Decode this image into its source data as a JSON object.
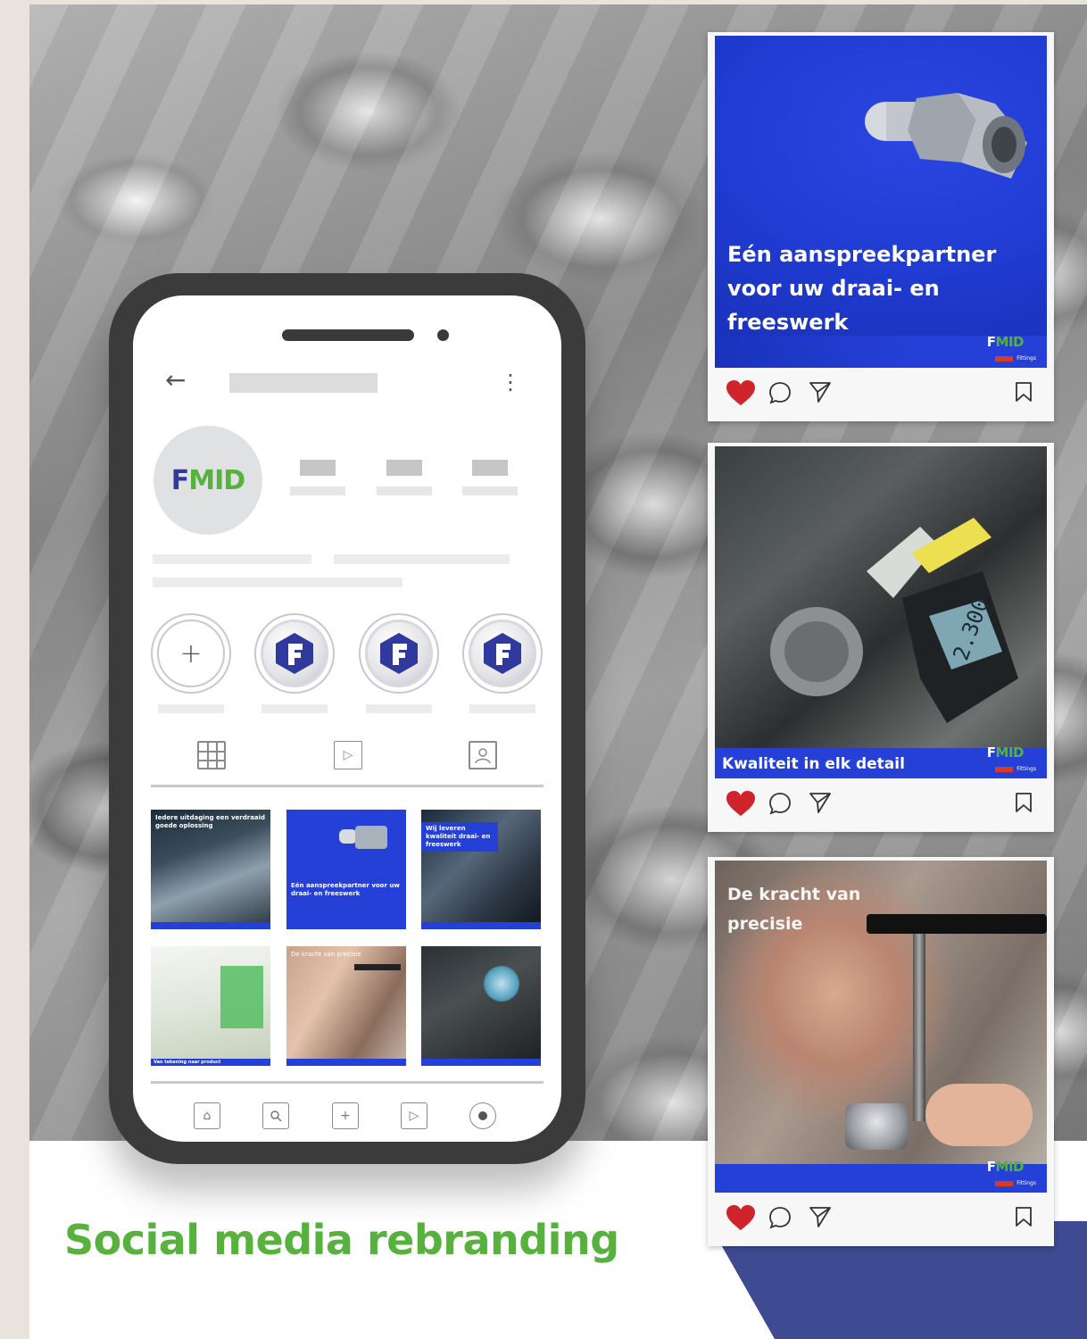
{
  "headline": "Social media rebranding",
  "colors": {
    "brand_blue": "#2440d6",
    "brand_green": "#56b13d",
    "navy": "#3e4a92",
    "heart": "#d0242c"
  },
  "profile": {
    "logo": {
      "f": "F",
      "rest": "MID"
    },
    "icons": {
      "back": "back-arrow-icon",
      "menu": "kebab-menu-icon",
      "add_highlight": "plus-icon",
      "tabs": [
        "grid-icon",
        "reels-icon",
        "tagged-icon"
      ],
      "bottom_nav": [
        "home-icon",
        "search-icon",
        "add-post-icon",
        "reels-icon",
        "profile-icon"
      ]
    }
  },
  "grid": [
    {
      "text": "Iedere uitdaging een verdraaid goede oplossing"
    },
    {
      "text": "Eén aanspreekpartner voor uw draai- en freeswerk"
    },
    {
      "text": "Wij leveren kwaliteit draai- en freeswerk"
    },
    {
      "text": "",
      "bar_text": "Van tekening naar product"
    },
    {
      "text": "De kracht van precisie"
    },
    {
      "text": ""
    }
  ],
  "posts": [
    {
      "caption": "Eén aanspreekpartner voor uw draai- en freeswerk",
      "tagline": "Fittings",
      "liked": true
    },
    {
      "caption": "Kwaliteit in elk detail",
      "tagline": "Fittings",
      "liked": true
    },
    {
      "caption": "De kracht van precisie",
      "tagline": "Fittings",
      "liked": true
    }
  ]
}
